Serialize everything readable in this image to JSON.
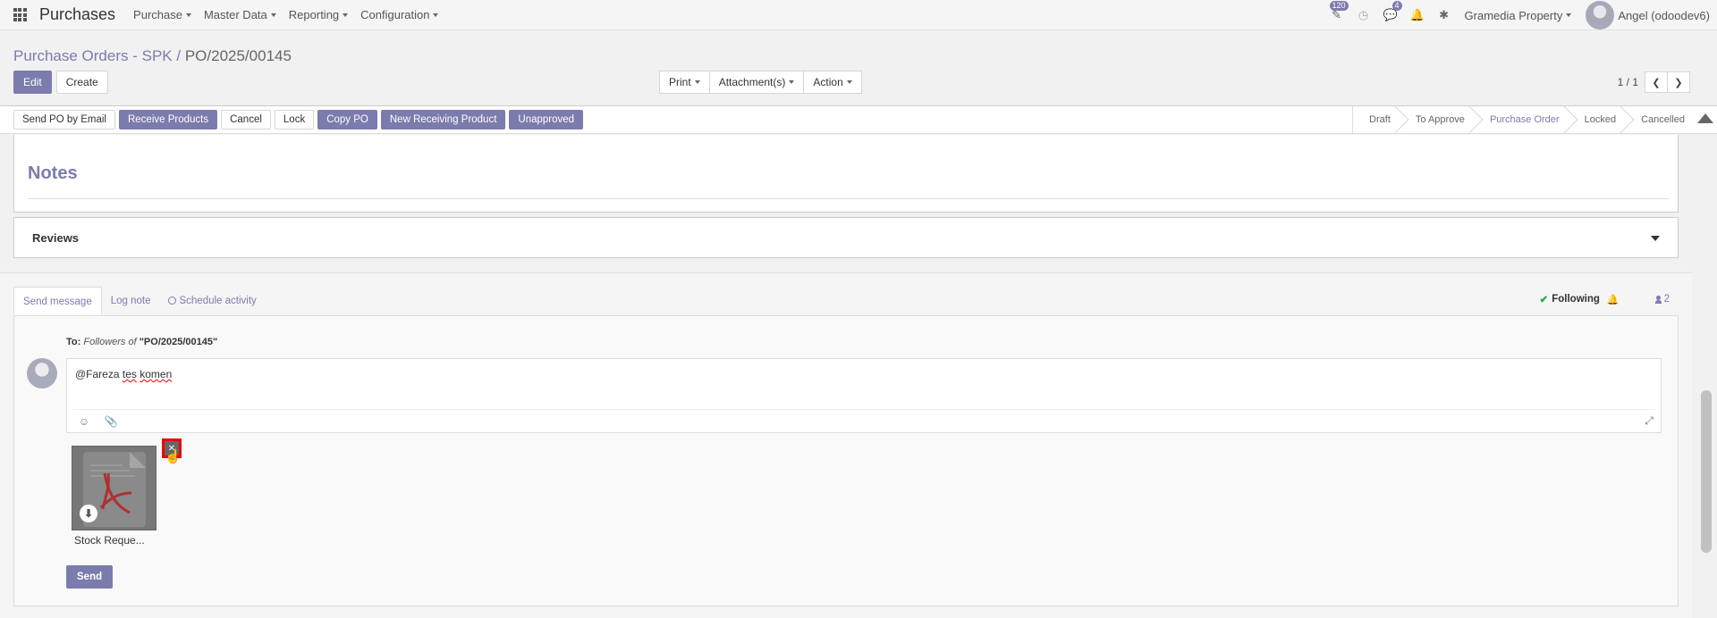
{
  "navbar": {
    "app_title": "Purchases",
    "menu": [
      "Purchase",
      "Master Data",
      "Reporting",
      "Configuration"
    ],
    "activity_badge": "120",
    "message_badge": "4",
    "company": "Gramedia Property",
    "user": "Angel (odoodev6)"
  },
  "breadcrumb": {
    "parent": "Purchase Orders - SPK",
    "separator": "/",
    "current": "PO/2025/00145"
  },
  "control_panel": {
    "edit": "Edit",
    "create": "Create",
    "print": "Print",
    "attachments": "Attachment(s)",
    "action": "Action",
    "pager": "1 / 1"
  },
  "status_buttons": [
    "Send PO by Email",
    "Receive Products",
    "Cancel",
    "Lock",
    "Copy PO",
    "New Receiving Product",
    "Unapproved"
  ],
  "stages": [
    "Draft",
    "To Approve",
    "Purchase Order",
    "Locked",
    "Cancelled"
  ],
  "active_stage": "Purchase Order",
  "sheet": {
    "notes_title": "Notes",
    "reviews_title": "Reviews"
  },
  "chatter": {
    "tabs": [
      "Send message",
      "Log note",
      "Schedule activity"
    ],
    "following": "Following",
    "followers_count": "2",
    "to_label": "To:",
    "followers_of": "Followers of",
    "record_ref": "\"PO/2025/00145\"",
    "message_prefix": "@Fareza ",
    "message_misspelled_1": "tes",
    "message_space": " ",
    "message_misspelled_2": "komen",
    "attachment_name": "Stock Reque...",
    "send": "Send"
  },
  "colors": {
    "primary": "#7c7bad",
    "following_check": "#28a745",
    "highlight": "#e00000"
  }
}
